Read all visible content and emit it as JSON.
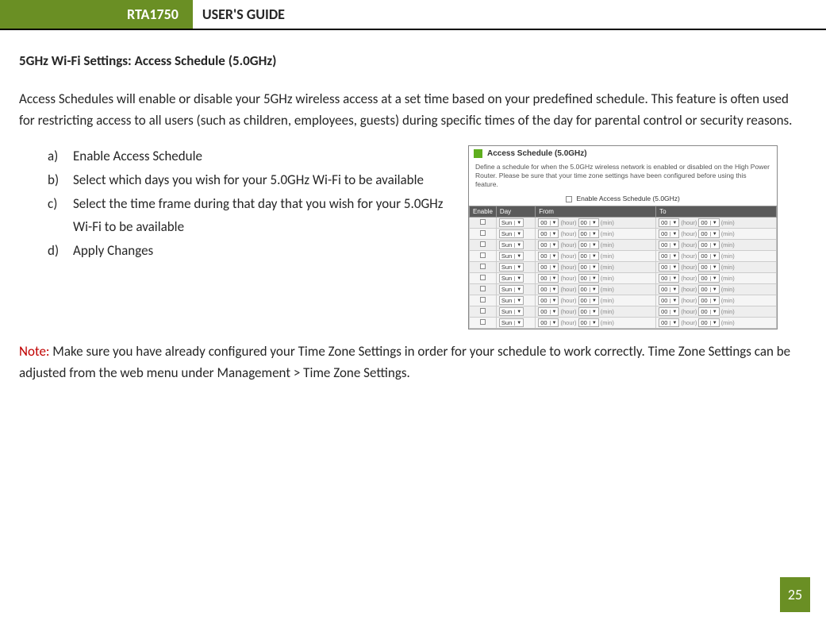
{
  "header": {
    "model": "RTA1750",
    "guide": "USER'S GUIDE"
  },
  "page_number": "25",
  "section_title": "5GHz Wi-Fi Settings: Access Schedule (5.0GHz)",
  "intro": "Access Schedules will enable or disable your 5GHz wireless access at a set time based on your predefined schedule. This feature is often used for restricting access to all users (such as children, employees, guests) during specific times of the day for parental control or security reasons.",
  "steps": [
    "Enable Access Schedule",
    "Select which days you wish for your 5.0GHz Wi-Fi to be available",
    "Select the time frame during that day that you wish for your 5.0GHz Wi-Fi to be available",
    "Apply Changes"
  ],
  "screenshot": {
    "title": "Access Schedule (5.0GHz)",
    "description": "Define a schedule for when the 5.0GHz wireless network is enabled or disabled on the High Power Router. Please be sure that your time zone settings have been configured before using this feature.",
    "enable_label": "Enable Access Schedule (5.0GHz)",
    "columns": {
      "enable": "Enable",
      "day": "Day",
      "from": "From",
      "to": "To"
    },
    "time_labels": {
      "hour": "(hour)",
      "min": "(min)"
    },
    "default_day": "Sun",
    "default_val": "00",
    "row_count": 10
  },
  "note": {
    "label": "Note:",
    "text": "  Make sure you have already configured your Time Zone Settings in order for your schedule to work correctly. Time Zone Settings can be adjusted from the web menu under Management > Time Zone Settings."
  }
}
